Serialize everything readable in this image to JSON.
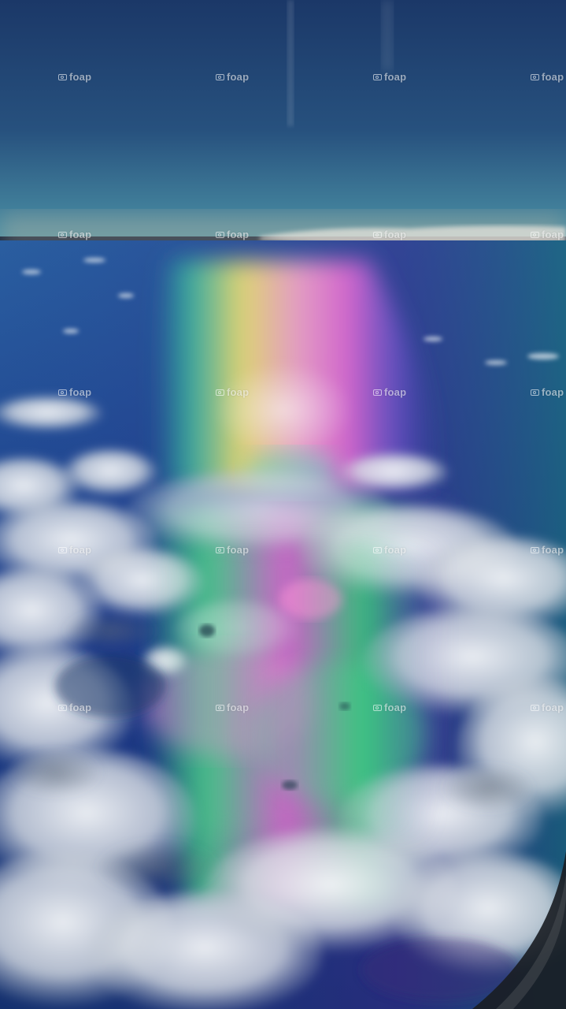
{
  "watermark": {
    "text": "foap",
    "icon": "camera-icon"
  },
  "colors": {
    "sky_top": "#1c3a6b",
    "sky_horizon": "#3f8aa0",
    "ocean": "#1f3f8e",
    "rainbow_yellow": "#f5e27a",
    "rainbow_pink": "#f06bd0",
    "rainbow_green": "#3fd68a",
    "cloud": "#e9ecef"
  }
}
